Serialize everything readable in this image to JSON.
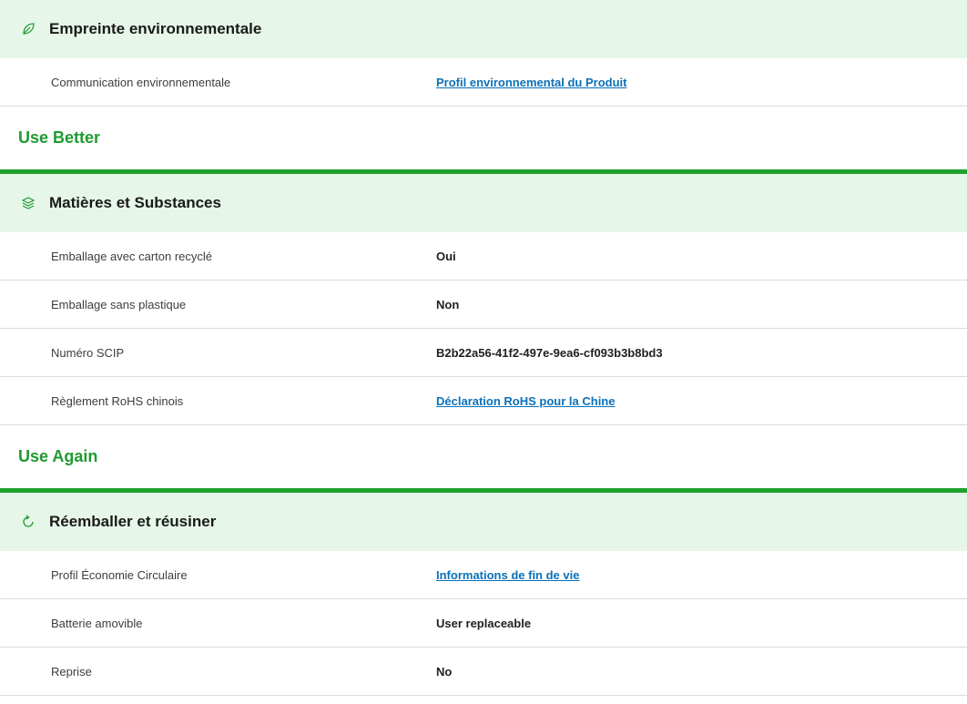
{
  "sections": [
    {
      "icon": "leaf-icon",
      "title": "Empreinte environnementale",
      "rows": [
        {
          "label": "Communication environnementale",
          "value": "Profil environnemental du Produit",
          "link": true
        }
      ]
    },
    {
      "icon": "layers-icon",
      "title": "Matières et Substances",
      "rows": [
        {
          "label": "Emballage avec carton recyclé",
          "value": "Oui",
          "link": false
        },
        {
          "label": "Emballage sans plastique",
          "value": "Non",
          "link": false
        },
        {
          "label": "Numéro SCIP",
          "value": "B2b22a56-41f2-497e-9ea6-cf093b3b8bd3",
          "link": false
        },
        {
          "label": "Règlement RoHS chinois",
          "value": "Déclaration RoHS pour la Chine",
          "link": true
        }
      ]
    },
    {
      "icon": "refresh-icon",
      "title": "Réemballer et réusiner",
      "rows": [
        {
          "label": "Profil Économie Circulaire",
          "value": "Informations de fin de vie",
          "link": true
        },
        {
          "label": "Batterie amovible",
          "value": "User replaceable",
          "link": false
        },
        {
          "label": "Reprise",
          "value": "No",
          "link": false
        }
      ]
    }
  ],
  "groups": {
    "use_better": "Use Better",
    "use_again": "Use Again"
  },
  "colors": {
    "header_bg": "#e6f7e9",
    "group_title": "#1f9a30",
    "group_rule": "#1fa12e",
    "link": "#0b71b8",
    "row_divider": "#dcdcdc"
  }
}
